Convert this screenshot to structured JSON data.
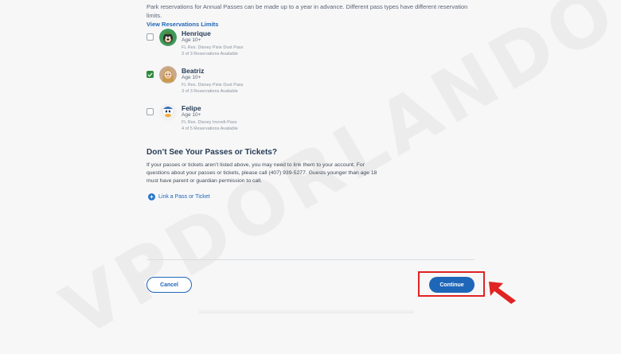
{
  "intro": {
    "text": "Park reservations for Annual Passes can be made up to a year in advance. Different pass types have different reservation limits.",
    "link": "View Reservations Limits"
  },
  "members": [
    {
      "name": "Henrique",
      "age": "Age 10+",
      "pass": "FL Res. Disney Pixie Dust Pass",
      "reservations": "3 of 3 Reservations Available",
      "checked": false,
      "avatar_icon": "goofy-avatar-icon"
    },
    {
      "name": "Beatriz",
      "age": "Age 10+",
      "pass": "FL Res. Disney Pixie Dust Pass",
      "reservations": "3 of 3 Reservations Available",
      "checked": true,
      "avatar_icon": "rapunzel-avatar-icon"
    },
    {
      "name": "Felipe",
      "age": "Age 10+",
      "pass": "FL Res. Disney Incredi-Pass",
      "reservations": "4 of 5 Reservations Available",
      "checked": false,
      "avatar_icon": "donald-avatar-icon"
    }
  ],
  "missing": {
    "heading": "Don’t See Your Passes or Tickets?",
    "body": "If your passes or tickets aren’t listed above, you may need to link them to your account. For questions about your passes or tickets, please call (407) 939-5277. Guests younger than age 18 must have parent or guardian permission to call.",
    "link": "Link a Pass or Ticket"
  },
  "actions": {
    "cancel": "Cancel",
    "continue": "Continue"
  },
  "watermark": "VPDORLANDO.COM",
  "colors": {
    "primary": "#1e66b8",
    "checked": "#2f8a3c",
    "highlight": "#e02323",
    "heading": "#253b56"
  }
}
